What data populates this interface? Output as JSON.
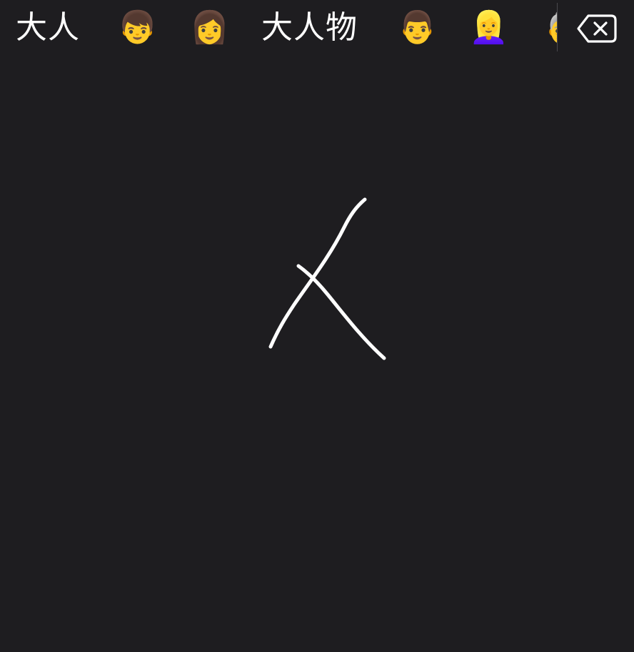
{
  "candidate_bar": {
    "items": [
      {
        "type": "text",
        "value": "大人"
      },
      {
        "type": "emoji",
        "value": "👦"
      },
      {
        "type": "emoji",
        "value": "👩"
      },
      {
        "type": "text",
        "value": "大人物"
      },
      {
        "type": "emoji",
        "value": "👨"
      },
      {
        "type": "emoji",
        "value": "👱‍♀️"
      },
      {
        "type": "emoji",
        "value": "👵"
      }
    ]
  },
  "delete_key": {
    "icon": "delete-backspace-icon"
  },
  "handwriting": {
    "stroke_color": "#ffffff",
    "background": "#1e1d20"
  }
}
